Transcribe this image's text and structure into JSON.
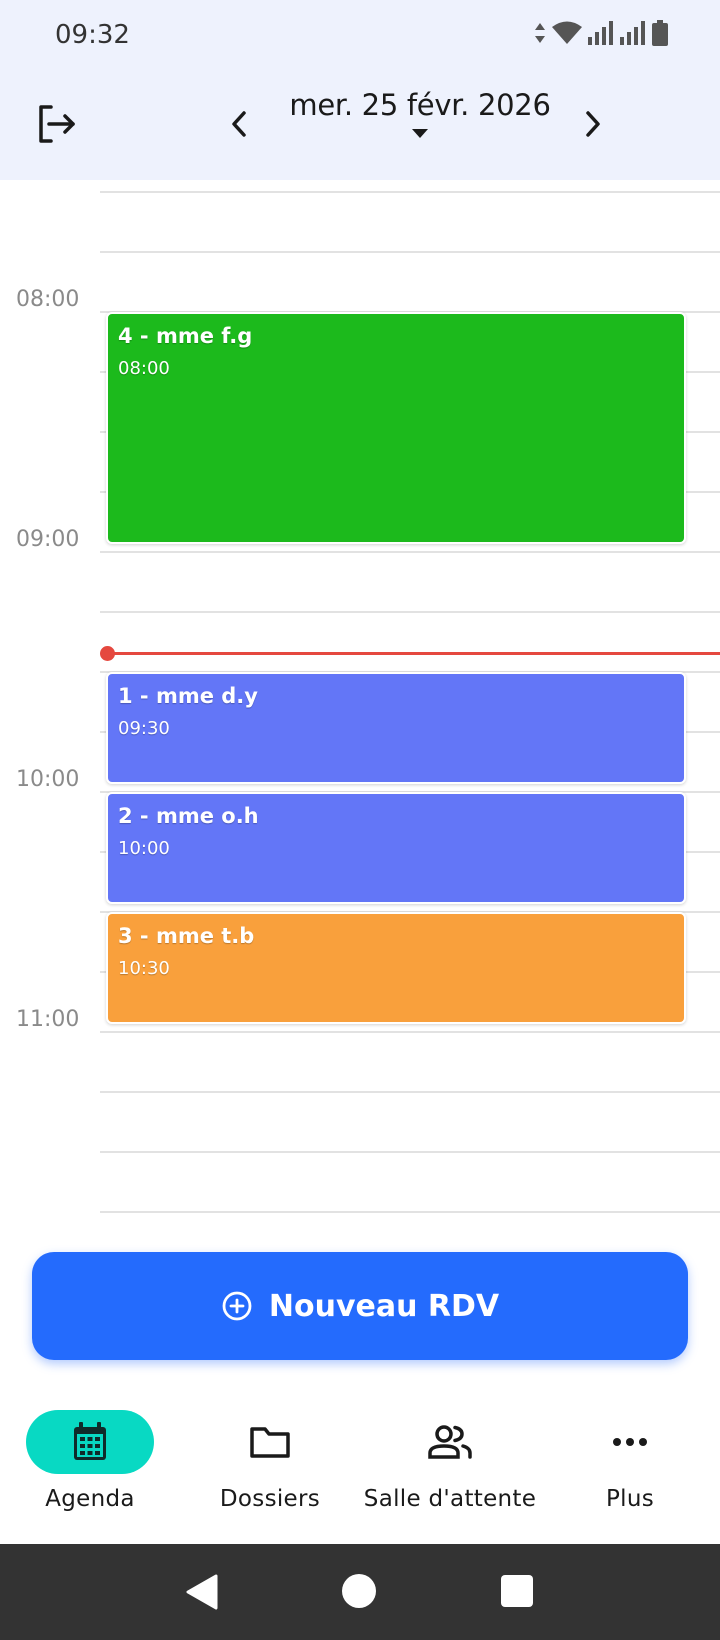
{
  "status_bar": {
    "time": "09:32"
  },
  "header": {
    "date": "mer. 25 févr. 2026",
    "icons": {
      "logout": "logout-icon",
      "prev": "chevron-left-icon",
      "next": "chevron-right-icon",
      "dropdown": "caret-down-icon"
    }
  },
  "calendar": {
    "hours": [
      "08:00",
      "09:00",
      "10:00",
      "11:00"
    ],
    "events": [
      {
        "title": "4 - mme f.g",
        "time": "08:00",
        "color": "#1cba1c"
      },
      {
        "title": "1 - mme d.y",
        "time": "09:30",
        "color": "#6376f7"
      },
      {
        "title": "2 - mme o.h",
        "time": "10:00",
        "color": "#6376f7"
      },
      {
        "title": "3 - mme t.b",
        "time": "10:30",
        "color": "#f9a03c"
      }
    ],
    "now_indicator_color": "#e5483f"
  },
  "new_appointment": {
    "label": "Nouveau RDV",
    "icon": "plus-circle-icon",
    "color": "#246bfd"
  },
  "bottom_nav": {
    "items": [
      {
        "label": "Agenda",
        "icon": "calendar-icon",
        "active": true
      },
      {
        "label": "Dossiers",
        "icon": "folder-icon",
        "active": false
      },
      {
        "label": "Salle d'attente",
        "icon": "people-icon",
        "active": false
      },
      {
        "label": "Plus",
        "icon": "more-horizontal-icon",
        "active": false
      }
    ],
    "active_color": "#08d9c3"
  }
}
